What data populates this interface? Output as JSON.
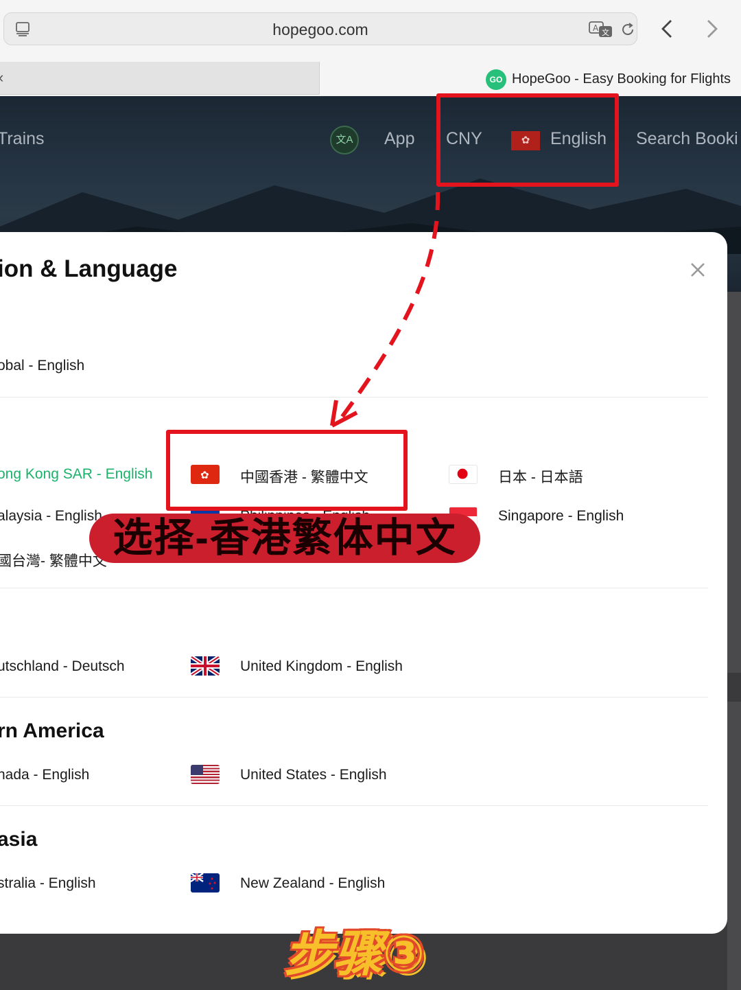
{
  "browser": {
    "url": "hopegoo.com",
    "tab_title": "HopeGoo - Easy Booking for Flights",
    "favicon_text": "GO"
  },
  "site_nav": {
    "trains": "Trains",
    "app": "App",
    "currency": "CNY",
    "language": "English",
    "search_booking": "Search Booki"
  },
  "modal": {
    "title": "ion & Language",
    "global": "obal - English",
    "asia_items": {
      "hk_en": "ong Kong SAR - English",
      "hk_tc": "中國香港 - 繁體中文",
      "jp": "日本 - 日本語",
      "my": "alaysia - English",
      "ph": "Philippines - English",
      "sg": "Singapore - English",
      "tw": "國台灣- 繁體中文"
    },
    "europe_items": {
      "de": "utschland - Deutsch",
      "uk": "United Kingdom - English"
    },
    "north_america": {
      "heading": "rn America",
      "ca": "nada - English",
      "us": "United States - English"
    },
    "oceania": {
      "heading": "asia",
      "au": "stralia - English",
      "nz": "New Zealand - English"
    }
  },
  "annotations": {
    "callout": "选择-香港繁体中文",
    "step": "步骤③"
  },
  "colors": {
    "accent_green": "#1bb26a",
    "annotation_red": "#e4141e"
  }
}
